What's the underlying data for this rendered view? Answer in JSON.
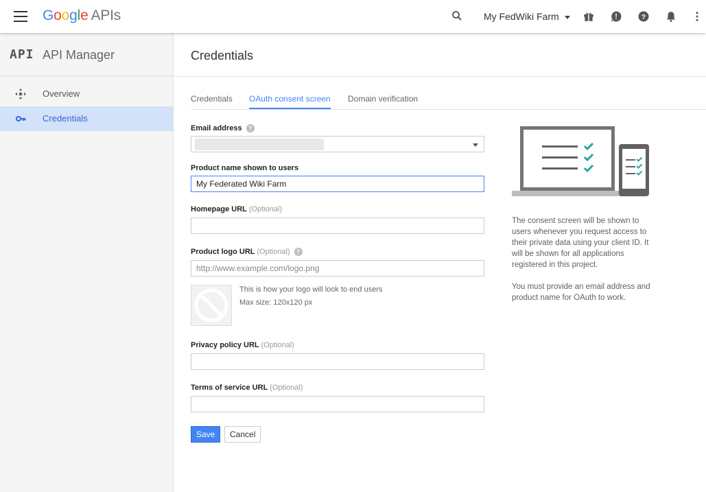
{
  "topbar": {
    "logo_letters": [
      "G",
      "o",
      "o",
      "g",
      "l",
      "e"
    ],
    "logo_suffix": "APIs",
    "project_name": "My FedWiki Farm"
  },
  "sidebar": {
    "title": "API Manager",
    "mark": "API",
    "items": [
      {
        "label": "Overview",
        "icon": "overview-icon",
        "active": false
      },
      {
        "label": "Credentials",
        "icon": "key-icon",
        "active": true
      }
    ]
  },
  "main": {
    "page_title": "Credentials",
    "tabs": [
      {
        "label": "Credentials",
        "active": false
      },
      {
        "label": "OAuth consent screen",
        "active": true
      },
      {
        "label": "Domain verification",
        "active": false
      }
    ]
  },
  "form": {
    "email_label": "Email address",
    "email_value": "",
    "product_name_label": "Product name shown to users",
    "product_name_value": "My Federated Wiki Farm",
    "homepage_label": "Homepage URL",
    "optional": "(Optional)",
    "homepage_value": "",
    "logo_label": "Product logo URL",
    "logo_placeholder": "http://www.example.com/logo.png",
    "logo_note_1": "This is how your logo will look to end users",
    "logo_note_2": "Max size: 120x120 px",
    "privacy_label": "Privacy policy URL",
    "privacy_value": "",
    "terms_label": "Terms of service URL",
    "terms_value": "",
    "save_label": "Save",
    "cancel_label": "Cancel"
  },
  "info": {
    "para1": "The consent screen will be shown to users whenever you request access to their private data using your client ID. It will be shown for all applications registered in this project.",
    "para2": "You must provide an email address and product name for OAuth to work."
  },
  "colors": {
    "accent": "#4285f4",
    "check_teal": "#26a69a",
    "sidebar_active_bg": "#d4e2f9"
  }
}
